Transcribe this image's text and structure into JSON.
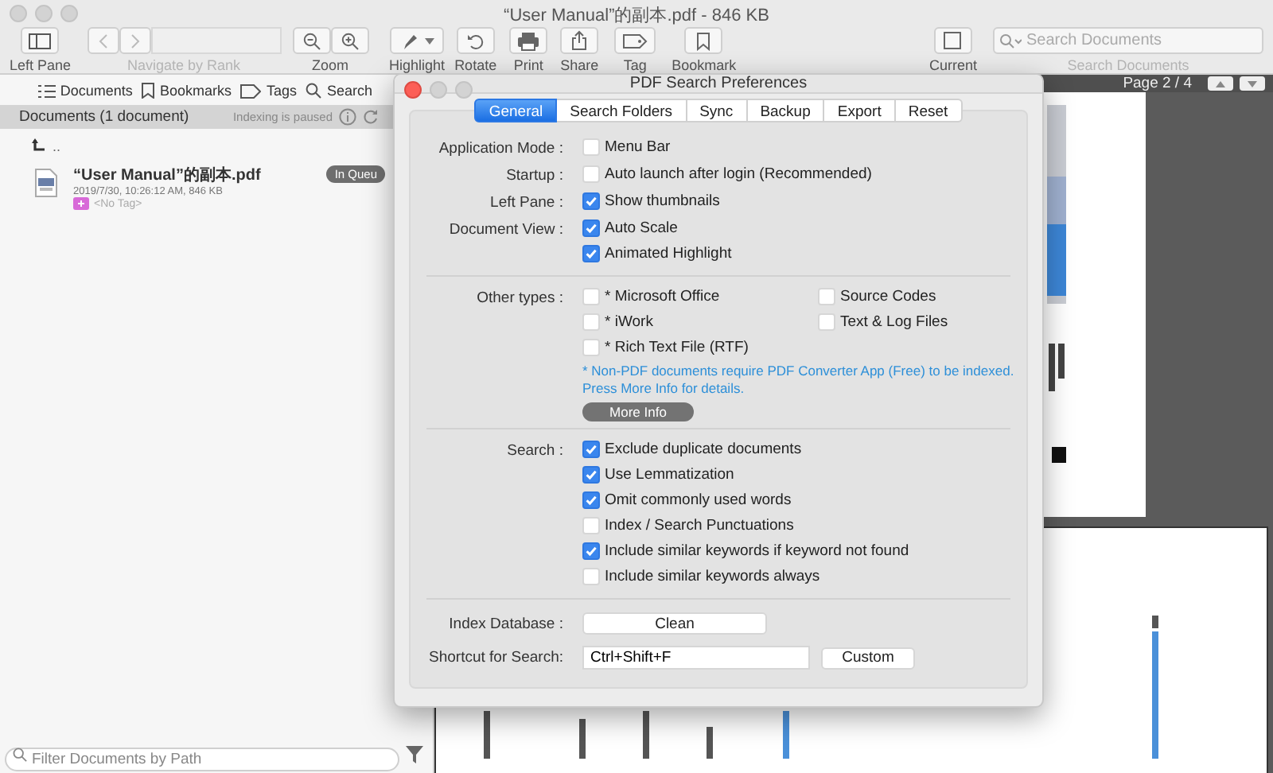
{
  "window": {
    "title": "“User Manual”的副本.pdf - 846 KB"
  },
  "toolbar": {
    "items": [
      {
        "kind": "pane",
        "label": "Left Pane",
        "disabled": false
      },
      {
        "kind": "nav",
        "label": "Navigate by Rank",
        "disabled": true
      },
      {
        "kind": "zoom",
        "label": "Zoom",
        "disabled": false
      },
      {
        "kind": "highlight",
        "label": "Highlight",
        "disabled": false
      },
      {
        "kind": "rotate",
        "label": "Rotate",
        "disabled": false
      },
      {
        "kind": "print",
        "label": "Print",
        "disabled": false
      },
      {
        "kind": "share",
        "label": "Share",
        "disabled": false
      },
      {
        "kind": "tag",
        "label": "Tag",
        "disabled": false
      },
      {
        "kind": "bookmark",
        "label": "Bookmark",
        "disabled": false
      },
      {
        "kind": "current",
        "label": "Current",
        "disabled": false
      }
    ],
    "search": {
      "placeholder": "Search Documents",
      "label": "Search Documents"
    }
  },
  "sidebar": {
    "tabs": [
      {
        "kind": "list",
        "label": "Documents"
      },
      {
        "kind": "bookmark",
        "label": "Bookmarks"
      },
      {
        "kind": "tag",
        "label": "Tags"
      },
      {
        "kind": "search",
        "label": "Search"
      }
    ],
    "header": "Documents (1 document)",
    "status": "Indexing is paused",
    "parent": "..",
    "documents": [
      {
        "name": "“User Manual”的副本.pdf",
        "meta": "2019/7/30, 10:26:12 AM, 846 KB",
        "tag": "<No Tag>",
        "badge": "In Queu"
      }
    ],
    "filter": {
      "placeholder": "Filter Documents by Path"
    }
  },
  "viewer": {
    "page": "Page 2 / 4"
  },
  "dialog": {
    "title": "PDF Search Preferences",
    "tabs": [
      {
        "label": "General",
        "selected": true
      },
      {
        "label": "Search Folders",
        "selected": false
      },
      {
        "label": "Sync",
        "selected": false
      },
      {
        "label": "Backup",
        "selected": false
      },
      {
        "label": "Export",
        "selected": false
      },
      {
        "label": "Reset",
        "selected": false
      }
    ],
    "groups": [
      {
        "rows": [
          {
            "kind": "checks",
            "label": "Application Mode :",
            "options": [
              {
                "label": "Menu Bar",
                "checked": false
              }
            ]
          },
          {
            "kind": "checks",
            "label": "Startup :",
            "options": [
              {
                "label": "Auto launch after login (Recommended)",
                "checked": false
              }
            ]
          },
          {
            "kind": "checks",
            "label": "Left Pane :",
            "options": [
              {
                "label": "Show thumbnails",
                "checked": true
              }
            ]
          },
          {
            "kind": "checks",
            "label": "Document View :",
            "options": [
              {
                "label": "Auto Scale",
                "checked": true
              },
              {
                "label": "Animated Highlight",
                "checked": true
              }
            ]
          }
        ]
      },
      {
        "rows": [
          {
            "kind": "grid",
            "label": "Other types :",
            "options": [
              {
                "label": "* Microsoft Office",
                "checked": false
              },
              {
                "label": "Source Codes",
                "checked": false
              },
              {
                "label": "* iWork",
                "checked": false
              },
              {
                "label": "Text & Log Files",
                "checked": false
              },
              {
                "label": "* Rich Text File (RTF)",
                "checked": false
              }
            ]
          }
        ],
        "note": [
          "* Non-PDF documents require PDF Converter App (Free) to be indexed.",
          "Press More Info for details."
        ],
        "more_button": "More Info"
      },
      {
        "rows": [
          {
            "kind": "checks",
            "label": "Search :",
            "options": [
              {
                "label": "Exclude duplicate documents",
                "checked": true
              },
              {
                "label": "Use Lemmatization",
                "checked": true
              },
              {
                "label": "Omit commonly used words",
                "checked": true
              },
              {
                "label": "Index / Search Punctuations",
                "checked": false
              },
              {
                "label": "Include similar keywords if keyword not found",
                "checked": true
              },
              {
                "label": "Include similar keywords always",
                "checked": false
              }
            ]
          }
        ]
      },
      {
        "rows": [
          {
            "kind": "button",
            "label": "Index Database :",
            "button": "Clean"
          },
          {
            "kind": "shortcut",
            "label": "Shortcut for Search:",
            "value": "Ctrl+Shift+F",
            "button": "Custom"
          }
        ]
      }
    ]
  }
}
